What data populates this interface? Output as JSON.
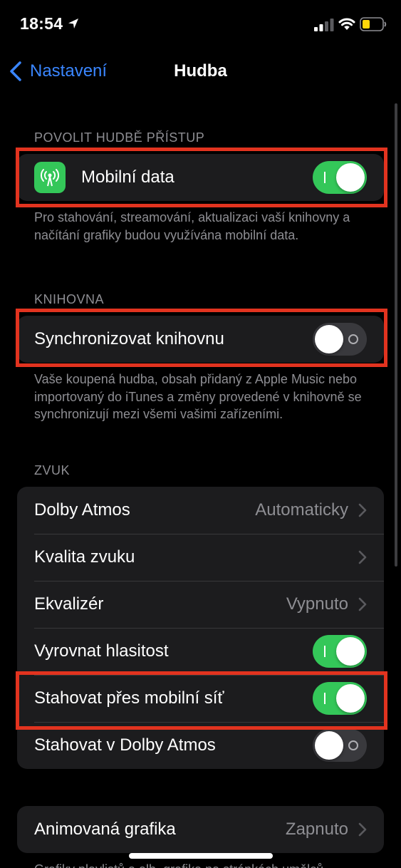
{
  "status_bar": {
    "time": "18:54",
    "icons": [
      "location-arrow-icon",
      "cellular-signal-icon",
      "wifi-icon",
      "battery-icon"
    ],
    "battery_color": "#ffd60a"
  },
  "nav": {
    "back_label": "Nastavení",
    "title": "Hudba"
  },
  "colors": {
    "accent": "#3a86ff",
    "toggle_on": "#34c759",
    "highlight": "#e2331f"
  },
  "sections": {
    "access": {
      "header": "POVOLIT HUDBĚ PŘÍSTUP",
      "mobile_data": {
        "label": "Mobilní data",
        "icon": "antenna-icon",
        "on": true
      },
      "footnote": "Pro stahování, streamování, aktualizaci vaší knihovny a načítání grafiky budou využívána mobilní data."
    },
    "library": {
      "header": "KNIHOVNA",
      "sync": {
        "label": "Synchronizovat knihovnu",
        "on": false
      },
      "footnote": "Vaše koupená hudba, obsah přidaný z Apple Music nebo importovaný do iTunes a změny provedené v knihovně se synchronizují mezi všemi vašimi zařízeními."
    },
    "sound": {
      "header": "ZVUK",
      "rows": {
        "dolby_atmos": {
          "label": "Dolby Atmos",
          "value": "Automaticky"
        },
        "audio_quality": {
          "label": "Kvalita zvuku"
        },
        "equalizer": {
          "label": "Ekvalizér",
          "value": "Vypnuto"
        },
        "sound_check": {
          "label": "Vyrovnat hlasitost",
          "on": true
        },
        "download_cellular": {
          "label": "Stahovat přes mobilní síť",
          "on": true
        },
        "download_dolby": {
          "label": "Stahovat v Dolby Atmos",
          "on": false
        }
      }
    },
    "artwork": {
      "animated": {
        "label": "Animovaná grafika",
        "value": "Zapnuto"
      },
      "footnote_partial": "Grafiky playlistů a alb, grafika na stránkách umělců"
    }
  }
}
